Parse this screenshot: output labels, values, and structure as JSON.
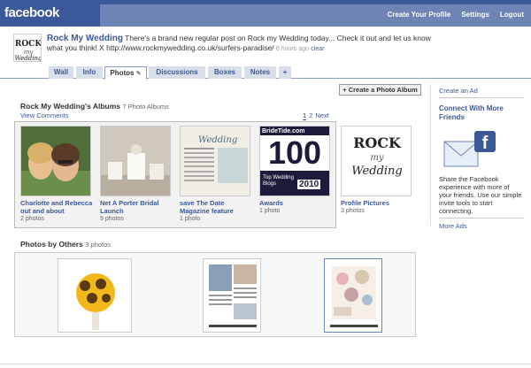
{
  "topbar": {
    "logo": "facebook",
    "nav": [
      "Create Your Profile",
      "Settings",
      "Logout"
    ]
  },
  "profile": {
    "name": "Rock My Wedding",
    "status": "There's a brand new regular post on Rock my Wedding today... Check it out and let us know what you think! X http://www.rockmywedding.co.uk/surfers-paradise/",
    "time": "6 hours ago",
    "clear": "clear"
  },
  "tabs": [
    {
      "label": "Wall"
    },
    {
      "label": "Info"
    },
    {
      "label": "Photos"
    },
    {
      "label": "Discussions"
    },
    {
      "label": "Boxes"
    },
    {
      "label": "Notes"
    },
    {
      "label": "+"
    }
  ],
  "albums": {
    "title": "Rock My Wedding's Albums",
    "count": "7 Photo Albums",
    "view_comments": "View Comments",
    "pager": [
      "1",
      "2",
      "Next"
    ],
    "create_label": "+ Create a Photo Album",
    "items": [
      {
        "title": "Charlotte and Rebecca out and about",
        "meta": "2 photos",
        "thumb_color": "#5a7a3a"
      },
      {
        "title": "Net A Porter Bridal Launch",
        "meta": "9 photos",
        "thumb_color": "#c9c2b8"
      },
      {
        "title": "save The Date Magazine feature",
        "meta": "1 photo",
        "thumb_color": "#e9e4dc"
      },
      {
        "title": "Awards",
        "meta": "1 photo",
        "thumb_color": "#1a1a3a",
        "badge_top": "BrideTide.com",
        "badge_num": "100",
        "badge_sub": "Top Wedding Blogs",
        "badge_year": "2010"
      },
      {
        "title": "Profile Pictures",
        "meta": "3 photos",
        "thumb_color": "#ffffff"
      }
    ]
  },
  "others": {
    "title": "Photos by Others",
    "count": "3 photos"
  },
  "sidebar": {
    "create_ad": "Create an Ad",
    "connect_title": "Connect With More Friends",
    "connect_body": "Share the Facebook experience with more of your friends. Use our simple invite tools to start connecting.",
    "more_ads": "More Ads"
  },
  "colors": {
    "brand": "#3b5998",
    "tab_bg": "#d8dfea"
  }
}
